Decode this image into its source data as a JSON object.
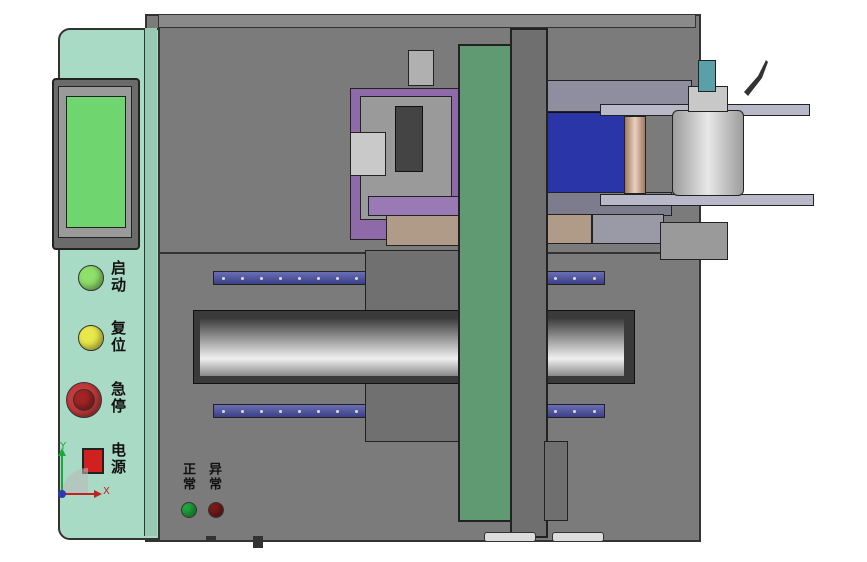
{
  "panel": {
    "buttons": [
      {
        "id": "start",
        "label": "启动",
        "color": "#8fe06a"
      },
      {
        "id": "reset",
        "label": "复位",
        "color": "#e8e84a"
      },
      {
        "id": "estop",
        "label": "急停",
        "color": "#c43a3a"
      },
      {
        "id": "power",
        "label": "电源",
        "color": "#d02020"
      }
    ],
    "status_lights": [
      {
        "id": "normal",
        "label": "正常",
        "color": "#1fa83a"
      },
      {
        "id": "abnormal",
        "label": "异常",
        "color": "#7a1a1a"
      }
    ]
  },
  "axes": {
    "x": "X",
    "y": "Y"
  },
  "colors": {
    "panel_bg": "#a8d9c5",
    "body_gray": "#7a7a7a",
    "screen_green": "#6fd66f",
    "slider_green": "#5f9a72",
    "belt_blue": "#2a35a8"
  }
}
